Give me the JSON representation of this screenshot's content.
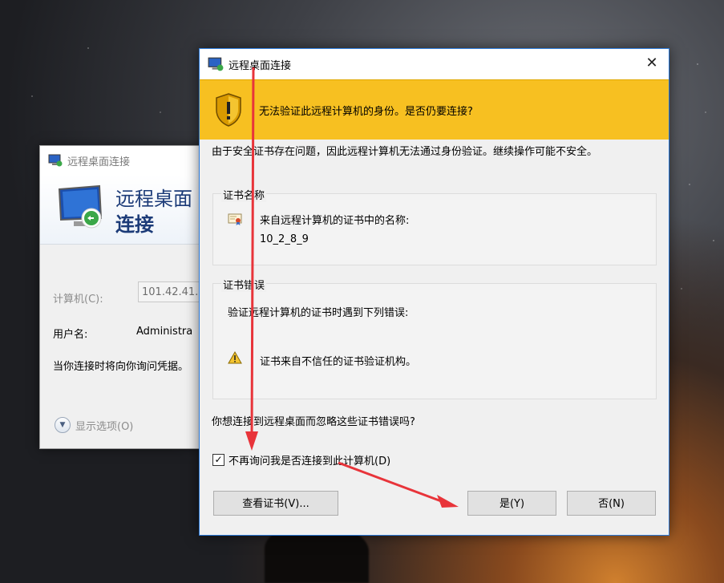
{
  "background_window": {
    "title": "远程桌面连接",
    "banner_line1": "远程桌面",
    "banner_line2": "连接",
    "computer_label": "计算机(C):",
    "computer_value": "101.42.41.",
    "username_label": "用户名:",
    "username_value": "Administra",
    "hint": "当你连接时将向你询问凭据。",
    "options_label": "显示选项(O)"
  },
  "dialog": {
    "title": "远程桌面连接",
    "close_glyph": "✕",
    "warning": "无法验证此远程计算机的身份。是否仍要连接?",
    "intro": "由于安全证书存在问题，因此远程计算机无法通过身份验证。继续操作可能不安全。",
    "cert_name_group": {
      "legend": "证书名称",
      "label": "来自远程计算机的证书中的名称:",
      "value": "10_2_8_9"
    },
    "cert_error_group": {
      "legend": "证书错误",
      "label": "验证远程计算机的证书时遇到下列错误:",
      "error": "证书来自不信任的证书验证机构。"
    },
    "question": "你想连接到远程桌面而忽略这些证书错误吗?",
    "checkbox_label": "不再询问我是否连接到此计算机(D)",
    "checkbox_checked": true,
    "buttons": {
      "view_cert": "查看证书(V)...",
      "yes": "是(Y)",
      "no": "否(N)"
    }
  },
  "colors": {
    "warning_bar": "#f7c021",
    "annotation_arrow": "#e8343a",
    "dialog_border": "#2b79d8"
  }
}
